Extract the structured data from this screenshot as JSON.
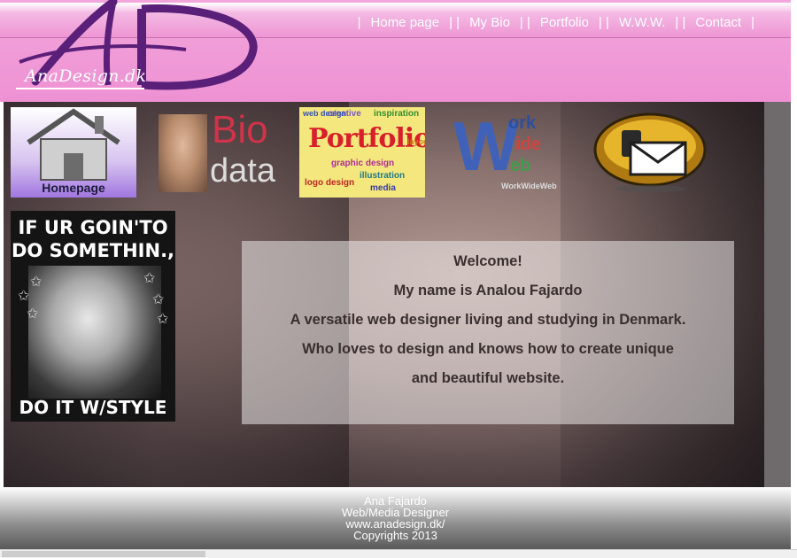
{
  "brand": {
    "initials": "AD",
    "site_name": "AnaDesign.dk",
    "colors": {
      "header_pink": "#ee91d3",
      "logo_purple": "#5a1f78",
      "text_dark": "#3a2f2f"
    }
  },
  "nav": {
    "items": [
      {
        "label": "Home page"
      },
      {
        "label": "My Bio"
      },
      {
        "label": "Portfolio"
      },
      {
        "label": "W.W.W."
      },
      {
        "label": "Contact"
      }
    ],
    "separator": "|"
  },
  "tiles": {
    "home": {
      "label": "Homepage",
      "icon": "house-icon"
    },
    "bio": {
      "word1": "Bio",
      "word2": "data"
    },
    "portfolio": {
      "title": "Portfolio",
      "tags": [
        "creative",
        "inspiration",
        "web design",
        "graphic design",
        "layout",
        "illustration",
        "logo design",
        "media"
      ]
    },
    "www": {
      "big_letter": "W",
      "small_lines": [
        "ork",
        "ide",
        "eb"
      ],
      "caption": "WorkWideWeb"
    },
    "contact": {
      "icon": "mail-icon"
    }
  },
  "poster": {
    "top_text": "IF UR GOIN'TO\nDO SOMETHIN.,",
    "bottom_text": "DO IT W/STYLE"
  },
  "welcome": {
    "lines": [
      "Welcome!",
      "My name is Analou Fajardo",
      "A versatile web designer living and studying in Denmark.",
      "Who loves to design and knows how to create unique",
      "and beautiful website."
    ]
  },
  "footer": {
    "lines": [
      "Ana Fajardo",
      "Web/Media Designer",
      "www.anadesign.dk/",
      "Copyrights 2013"
    ]
  }
}
